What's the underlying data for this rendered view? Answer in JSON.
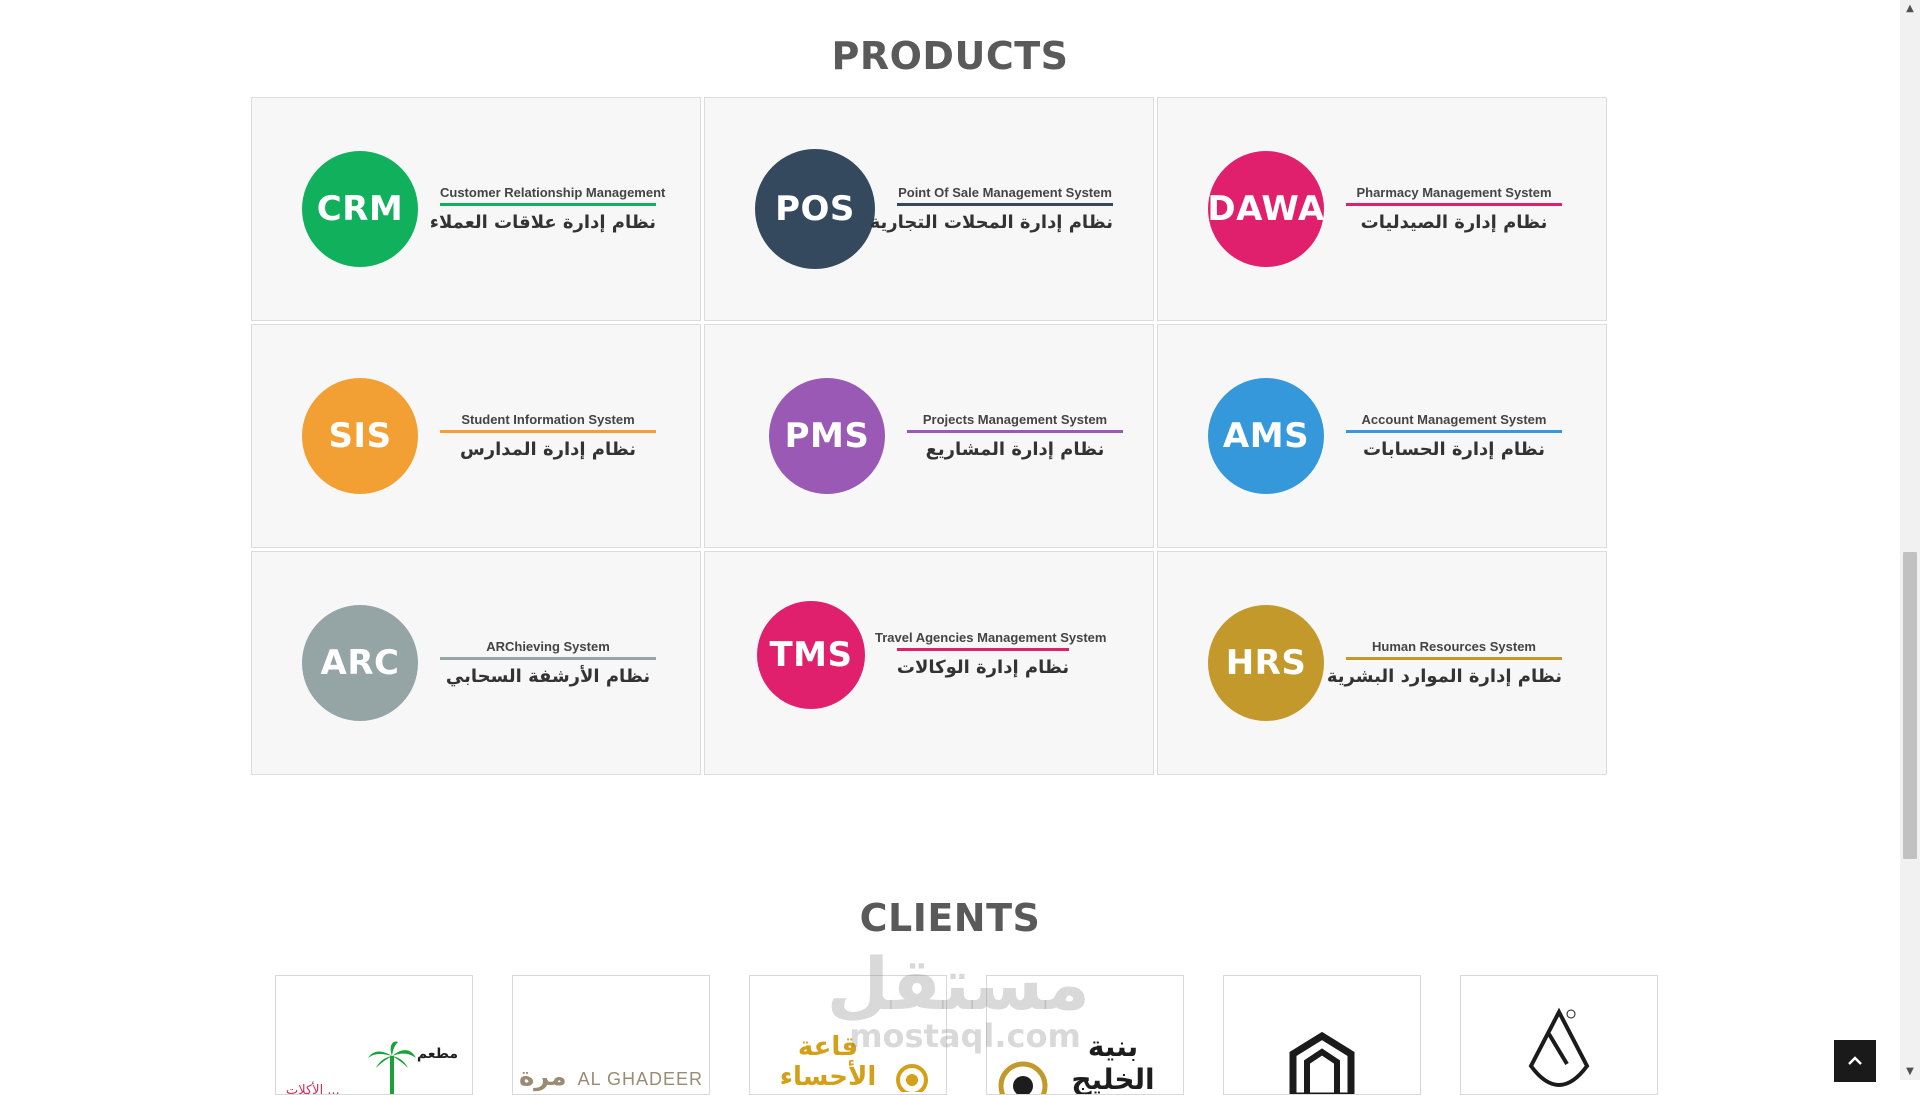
{
  "products": {
    "title": "PRODUCTS",
    "items": [
      {
        "code": "CRM",
        "color": "#10b05c",
        "underline": "#10b05c",
        "en": "Customer Relationship Management",
        "ar": "نظام إدارة علاقات العملاء"
      },
      {
        "code": "POS",
        "color": "#34495e",
        "underline": "#34495e",
        "en": "Point Of Sale Management System",
        "ar": "نظام إدارة المحلات التجارية"
      },
      {
        "code": "DAWA",
        "color": "#e0206d",
        "underline": "#e0206d",
        "en": "Pharmacy Management System",
        "ar": "نظام إدارة الصيدليات"
      },
      {
        "code": "SIS",
        "color": "#f2a033",
        "underline": "#f2a033",
        "en": "Student Information System",
        "ar": "نظام إدارة المدارس"
      },
      {
        "code": "PMS",
        "color": "#9b59b6",
        "underline": "#9b59b6",
        "en": "Projects Management System",
        "ar": "نظام إدارة المشاريع"
      },
      {
        "code": "AMS",
        "color": "#3598db",
        "underline": "#3598db",
        "en": "Account Management System",
        "ar": "نظام إدارة الحسابات"
      },
      {
        "code": "ARC",
        "color": "#95a5a6",
        "underline": "#95a5a6",
        "en": "ARChieving System",
        "ar": "نظام الأرشفة السحابي"
      },
      {
        "code": "TMS",
        "color": "#e0206d",
        "underline": "#e0206d",
        "en": "Travel Agencies Management System",
        "ar": "نظام إدارة الوكالات"
      },
      {
        "code": "HRS",
        "color": "#c4992b",
        "underline": "#c4992b",
        "en": "Human Resources System",
        "ar": "نظام إدارة الموارد البشرية"
      }
    ]
  },
  "clients": {
    "title": "CLIENTS",
    "logos": [
      {
        "name": "palm-restaurant-logo",
        "ar_line1": "مطعم",
        "ar_line2": "... الأكلات"
      },
      {
        "name": "al-ghadeer-logo",
        "en": "AL GHADEER",
        "ar": "مرة"
      },
      {
        "name": "al-ahsa-hall-logo",
        "ar": "قاعة الأحساء"
      },
      {
        "name": "gulf-structure-logo",
        "ar": "بنية الخليج"
      },
      {
        "name": "building-emblem-logo"
      },
      {
        "name": "pharmacy-mortar-logo"
      }
    ]
  },
  "watermark": {
    "ar": "مستقل",
    "en": "mostaql.com"
  },
  "controls": {
    "back_to_top_icon": "chevron-up-icon"
  }
}
